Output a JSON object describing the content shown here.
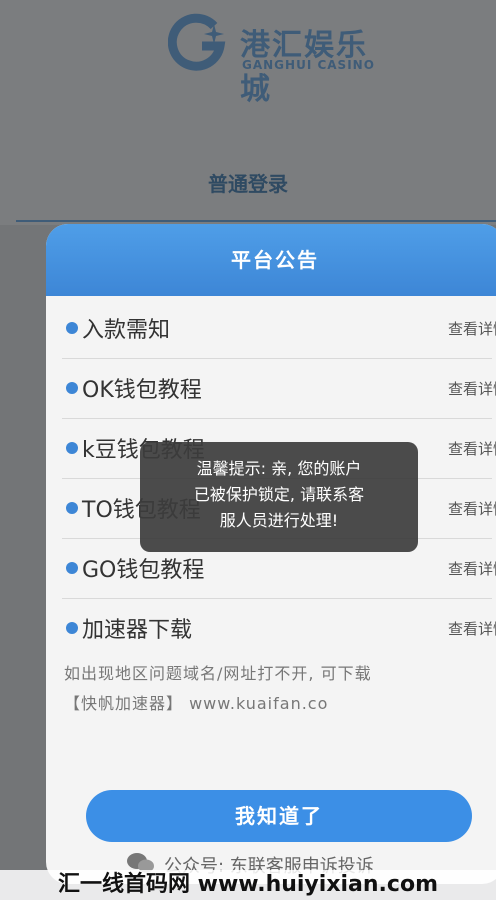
{
  "brand": {
    "name_cn": "港汇娱乐城",
    "name_en": "GANGHUI CASINO"
  },
  "login": {
    "tab_label": "普通登录"
  },
  "modal": {
    "title": "平台公告",
    "items": [
      {
        "label": "入款需知",
        "action": "查看详情"
      },
      {
        "label": "OK钱包教程",
        "action": "查看详情"
      },
      {
        "label": "k豆钱包教程",
        "action": "查看详情"
      },
      {
        "label": "TO钱包教程",
        "action": "查看详情"
      },
      {
        "label": "GO钱包教程",
        "action": "查看详情"
      },
      {
        "label": "加速器下载",
        "action": "查看详情"
      }
    ],
    "note_line1": "如出现地区问题域名/网址打不开, 可下载",
    "note_line2": "【快帆加速器】 www.kuaifan.co",
    "confirm_label": "我知道了",
    "footer_text": "公众号: 东联客服申诉投诉"
  },
  "toast": {
    "line1": "温馨提示: 亲, 您的账户",
    "line2": "已被保护锁定, 请联系客",
    "line3": "服人员进行处理!"
  },
  "watermark": "汇一线首码网 www.huiyixian.com",
  "colors": {
    "accent": "#3d86d6",
    "header": "#4f9ee8",
    "brand": "#3f5c78"
  }
}
